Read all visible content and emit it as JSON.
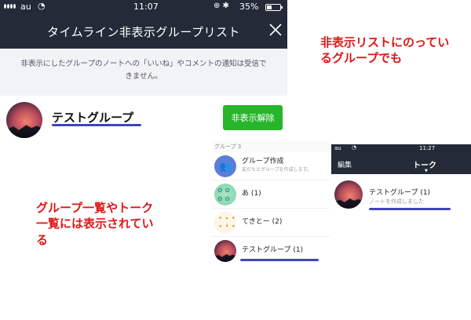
{
  "left_screen": {
    "status": {
      "carrier": "au",
      "time": "11:07",
      "icons": "⊕ ✱",
      "battery": "35%"
    },
    "title": "タイムライン非表示グループリスト",
    "notice_line1": "非表示にしたグループのノートへの「いいね」やコメントの通知は受信で",
    "notice_line2": "きません。",
    "group_name": "テストグループ",
    "unhide_button": "非表示解除"
  },
  "annotations": {
    "top_line1": "非表示リストにのってい",
    "top_line2": "るグループでも",
    "bottom_line1": "グループ一覧やトーク",
    "bottom_line2": "一覧には表示されてい",
    "bottom_line3": "る"
  },
  "group_list": {
    "header": "グループ 3",
    "items": [
      {
        "label": "グループ作成",
        "sub": "友だちとグループを作成します。"
      },
      {
        "label": "あ  (1)"
      },
      {
        "label": "てきとー  (2)"
      },
      {
        "label": "テストグループ  (1)"
      }
    ]
  },
  "chat_list": {
    "status_carrier": "au",
    "status_time": "11:27",
    "edit": "編集",
    "title": "トーク",
    "chat_name": "テストグループ  (1)",
    "chat_preview": "ノートを作成しました"
  },
  "colors": {
    "nav_bg": "#242a37",
    "unhide_green": "#27b52c",
    "annotation_red": "#e01616",
    "underline_blue": "#3f45b9"
  }
}
